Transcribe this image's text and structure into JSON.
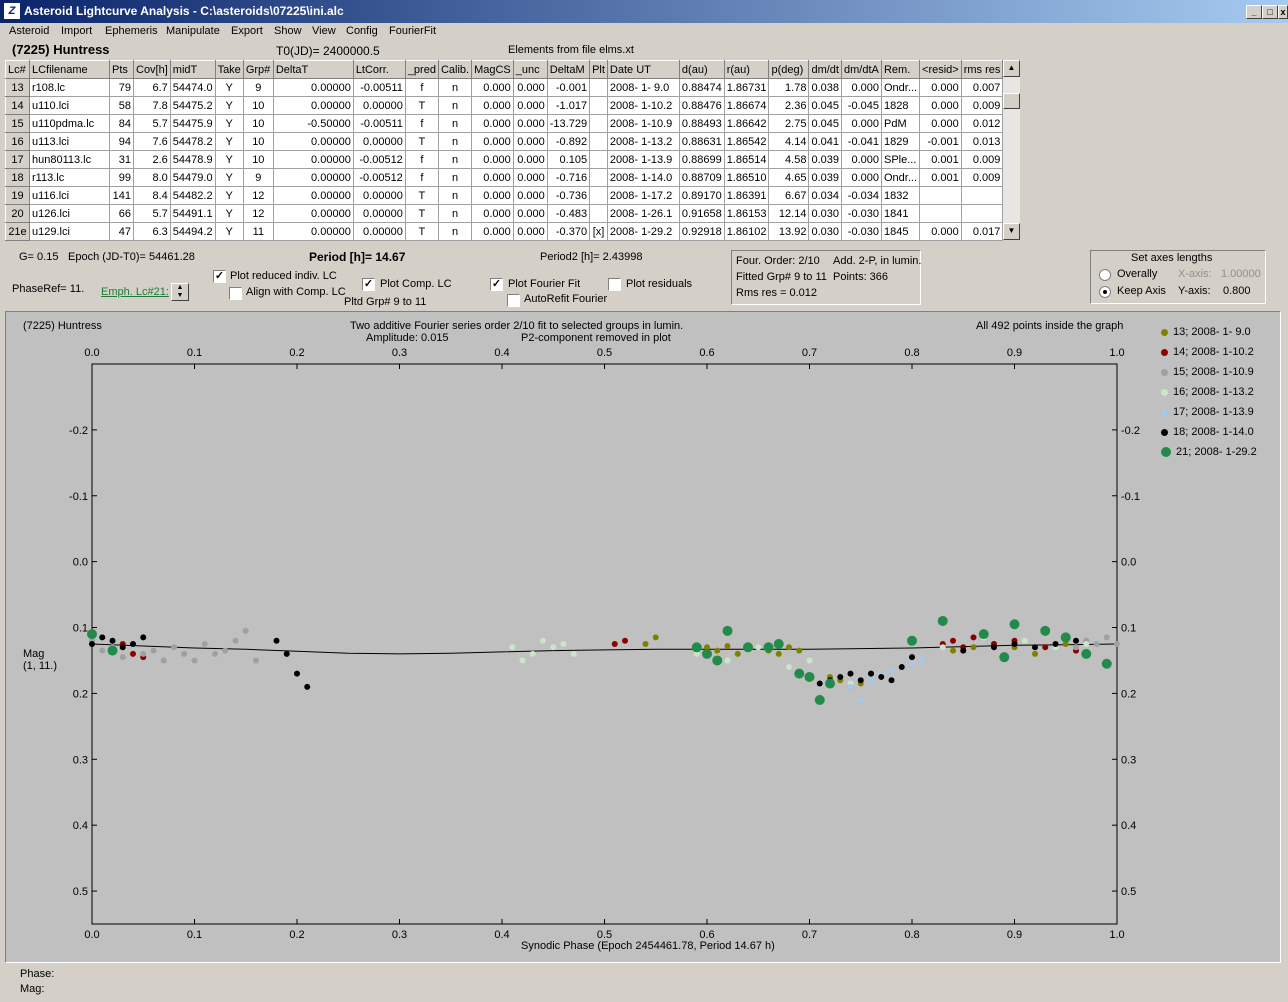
{
  "window": {
    "title": "Asteroid Lightcurve Analysis - C:\\asteroids\\07225\\ini.alc",
    "logo": "Z"
  },
  "menu": [
    "Asteroid",
    "Import",
    "Ephemeris",
    "Manipulate",
    "Export",
    "Show",
    "View",
    "Config",
    "FourierFit"
  ],
  "header": {
    "asteroid": "(7225) Huntress",
    "t0": "T0(JD)= 2400000.5",
    "elements": "Elements from file elms.xt"
  },
  "table": {
    "columns": [
      "Lc#",
      "LCfilename",
      "Pts",
      "Cov[h]",
      "midT",
      "Take",
      "Grp#",
      "DeltaT",
      "LtCorr.",
      "_pred",
      "Calib.",
      "MagCS",
      "_unc",
      "DeltaM",
      "Plt",
      "Date UT",
      "d(au)",
      "r(au)",
      "p(deg)",
      "dm/dt",
      "dm/dtA",
      "Rem.",
      "<resid>",
      "rms res"
    ],
    "rows": [
      [
        "13",
        "r108.lc",
        "79",
        "6.7",
        "54474.0",
        "Y",
        "9",
        "0.00000",
        "-0.00511",
        "f",
        "n",
        "0.000",
        "0.000",
        "-0.001",
        "",
        "2008- 1- 9.0",
        "0.88474",
        "1.86731",
        "1.78",
        "0.038",
        "0.000",
        "Ondr...",
        "0.000",
        "0.007"
      ],
      [
        "14",
        "u110.lci",
        "58",
        "7.8",
        "54475.2",
        "Y",
        "10",
        "0.00000",
        "0.00000",
        "T",
        "n",
        "0.000",
        "0.000",
        "-1.017",
        "",
        "2008- 1-10.2",
        "0.88476",
        "1.86674",
        "2.36",
        "0.045",
        "-0.045",
        "1828",
        "0.000",
        "0.009"
      ],
      [
        "15",
        "u110pdma.lc",
        "84",
        "5.7",
        "54475.9",
        "Y",
        "10",
        "-0.50000",
        "-0.00511",
        "f",
        "n",
        "0.000",
        "0.000",
        "-13.729",
        "",
        "2008- 1-10.9",
        "0.88493",
        "1.86642",
        "2.75",
        "0.045",
        "0.000",
        "PdM",
        "0.000",
        "0.012"
      ],
      [
        "16",
        "u113.lci",
        "94",
        "7.6",
        "54478.2",
        "Y",
        "10",
        "0.00000",
        "0.00000",
        "T",
        "n",
        "0.000",
        "0.000",
        "-0.892",
        "",
        "2008- 1-13.2",
        "0.88631",
        "1.86542",
        "4.14",
        "0.041",
        "-0.041",
        "1829",
        "-0.001",
        "0.013"
      ],
      [
        "17",
        "hun80113.lc",
        "31",
        "2.6",
        "54478.9",
        "Y",
        "10",
        "0.00000",
        "-0.00512",
        "f",
        "n",
        "0.000",
        "0.000",
        "0.105",
        "",
        "2008- 1-13.9",
        "0.88699",
        "1.86514",
        "4.58",
        "0.039",
        "0.000",
        "SPle...",
        "0.001",
        "0.009"
      ],
      [
        "18",
        "r113.lc",
        "99",
        "8.0",
        "54479.0",
        "Y",
        "9",
        "0.00000",
        "-0.00512",
        "f",
        "n",
        "0.000",
        "0.000",
        "-0.716",
        "",
        "2008- 1-14.0",
        "0.88709",
        "1.86510",
        "4.65",
        "0.039",
        "0.000",
        "Ondr...",
        "0.001",
        "0.009"
      ],
      [
        "19",
        "u116.lci",
        "141",
        "8.4",
        "54482.2",
        "Y",
        "12",
        "0.00000",
        "0.00000",
        "T",
        "n",
        "0.000",
        "0.000",
        "-0.736",
        "",
        "2008- 1-17.2",
        "0.89170",
        "1.86391",
        "6.67",
        "0.034",
        "-0.034",
        "1832",
        "",
        ""
      ],
      [
        "20",
        "u126.lci",
        "66",
        "5.7",
        "54491.1",
        "Y",
        "12",
        "0.00000",
        "0.00000",
        "T",
        "n",
        "0.000",
        "0.000",
        "-0.483",
        "",
        "2008- 1-26.1",
        "0.91658",
        "1.86153",
        "12.14",
        "0.030",
        "-0.030",
        "1841",
        "",
        ""
      ],
      [
        "21e",
        "u129.lci",
        "47",
        "6.3",
        "54494.2",
        "Y",
        "11",
        "0.00000",
        "0.00000",
        "T",
        "n",
        "0.000",
        "0.000",
        "-0.370",
        "[x]",
        "2008- 1-29.2",
        "0.92918",
        "1.86102",
        "13.92",
        "0.030",
        "-0.030",
        "1845",
        "0.000",
        "0.017"
      ]
    ]
  },
  "controls": {
    "g": "G= 0.15",
    "epoch": "Epoch (JD-T0)= 54461.28",
    "period": "Period [h]= 14.67",
    "period2": "Period2 [h]= 2.43998",
    "phaseref": "PhaseRef= 11.",
    "emph": "Emph. Lc#21:",
    "plot_reduced": "Plot reduced indiv. LC",
    "align": "Align with Comp. LC",
    "plot_comp": "Plot Comp. LC",
    "pltd_grp": "Pltd Grp#  9   to   11",
    "plot_fourier": "Plot Fourier Fit",
    "autorefit": "AutoRefit Fourier",
    "plot_resid": "Plot residuals",
    "checks": {
      "plot_reduced": true,
      "align": false,
      "plot_comp": true,
      "plot_fourier": true,
      "autorefit": false,
      "plot_resid": false
    },
    "fourier_info": [
      "Four. Order:  2/10",
      "Add. 2-P, in lumin.",
      "Fitted Grp# 9 to 11",
      "Points: 366",
      "Rms res      = 0.012"
    ],
    "axes": {
      "title": "Set axes lengths",
      "overally": "Overally",
      "keep": "Keep Axis",
      "xaxis_label": "X-axis:",
      "xaxis_val": "1.00000",
      "yaxis_label": "Y-axis:",
      "yaxis_val": "0.800",
      "selected": "keep"
    }
  },
  "chart_data": {
    "type": "scatter",
    "title": "Two additive Fourier series order 2/10 fit to selected groups in lumin.",
    "subtitle": "Amplitude: 0.015",
    "note": "P2-component removed in plot",
    "object": "(7225) Huntress",
    "points_note": "All 492 points inside the graph",
    "xlabel": "Synodic Phase (Epoch 2454461.78, Period 14.67 h)",
    "ylabel": "Mag\n(1, 11.)",
    "xlim": [
      0,
      1
    ],
    "ylim": [
      -0.3,
      0.55
    ],
    "x_ticks": [
      "0.0",
      "0.1",
      "0.2",
      "0.3",
      "0.4",
      "0.5",
      "0.6",
      "0.7",
      "0.8",
      "0.9",
      "1.0"
    ],
    "y_ticks": [
      "-0.2",
      "-0.1",
      "0.0",
      "0.1",
      "0.2",
      "0.3",
      "0.4",
      "0.5"
    ],
    "legend": [
      {
        "label": "13; 2008- 1- 9.0",
        "color": "#808000"
      },
      {
        "label": "14; 2008- 1-10.2",
        "color": "#8b0000"
      },
      {
        "label": "15; 2008- 1-10.9",
        "color": "#a0a0a0"
      },
      {
        "label": "16; 2008- 1-13.2",
        "color": "#c8e6c8"
      },
      {
        "label": "17; 2008- 1-13.9",
        "color": "#a8c8e8"
      },
      {
        "label": "18; 2008- 1-14.0",
        "color": "#000000"
      },
      {
        "label": "21; 2008- 1-29.2",
        "color": "#228b4b"
      }
    ],
    "fit": {
      "x": [
        0,
        0.05,
        0.1,
        0.15,
        0.2,
        0.25,
        0.3,
        0.35,
        0.4,
        0.45,
        0.5,
        0.55,
        0.6,
        0.65,
        0.7,
        0.75,
        0.8,
        0.85,
        0.9,
        0.95,
        1.0
      ],
      "y": [
        0.125,
        0.128,
        0.131,
        0.133,
        0.136,
        0.139,
        0.14,
        0.139,
        0.137,
        0.135,
        0.134,
        0.133,
        0.133,
        0.133,
        0.133,
        0.132,
        0.131,
        0.129,
        0.127,
        0.126,
        0.125
      ]
    },
    "series": [
      {
        "name": "13; 2008- 1- 9.0",
        "color": "#808000",
        "r": 3,
        "x": [
          0.54,
          0.55,
          0.6,
          0.61,
          0.62,
          0.63,
          0.64,
          0.66,
          0.67,
          0.68,
          0.69,
          0.72,
          0.73,
          0.74,
          0.75,
          0.76,
          0.84,
          0.86,
          0.88,
          0.9,
          0.92,
          0.95,
          0.97
        ],
        "y": [
          0.125,
          0.115,
          0.13,
          0.135,
          0.128,
          0.14,
          0.13,
          0.135,
          0.14,
          0.13,
          0.135,
          0.175,
          0.18,
          0.19,
          0.185,
          0.17,
          0.135,
          0.13,
          0.125,
          0.13,
          0.14,
          0.125,
          0.12
        ]
      },
      {
        "name": "14; 2008- 1-10.2",
        "color": "#8b0000",
        "r": 3,
        "x": [
          0.03,
          0.04,
          0.05,
          0.51,
          0.52,
          0.83,
          0.84,
          0.85,
          0.86,
          0.88,
          0.9,
          0.93,
          0.96
        ],
        "y": [
          0.125,
          0.14,
          0.145,
          0.125,
          0.12,
          0.125,
          0.12,
          0.13,
          0.115,
          0.125,
          0.12,
          0.13,
          0.135
        ]
      },
      {
        "name": "15; 2008- 1-10.9",
        "color": "#a0a0a0",
        "r": 3,
        "x": [
          0.0,
          0.01,
          0.02,
          0.03,
          0.05,
          0.06,
          0.07,
          0.08,
          0.09,
          0.1,
          0.11,
          0.12,
          0.13,
          0.14,
          0.15,
          0.16,
          0.95,
          0.96,
          0.97,
          0.98,
          0.99,
          1.0
        ],
        "y": [
          0.12,
          0.135,
          0.13,
          0.145,
          0.14,
          0.135,
          0.15,
          0.13,
          0.14,
          0.15,
          0.125,
          0.14,
          0.135,
          0.12,
          0.105,
          0.15,
          0.115,
          0.13,
          0.12,
          0.125,
          0.115,
          0.125
        ]
      },
      {
        "name": "16; 2008- 1-13.2",
        "color": "#c8e6c8",
        "r": 3,
        "x": [
          0.41,
          0.42,
          0.43,
          0.44,
          0.45,
          0.46,
          0.47,
          0.59,
          0.62,
          0.65,
          0.68,
          0.7,
          0.74,
          0.77,
          0.8,
          0.83,
          0.87,
          0.91,
          0.94,
          0.97
        ],
        "y": [
          0.13,
          0.15,
          0.14,
          0.12,
          0.13,
          0.125,
          0.14,
          0.14,
          0.15,
          0.13,
          0.16,
          0.15,
          0.185,
          0.17,
          0.145,
          0.13,
          0.115,
          0.12,
          0.13,
          0.125
        ]
      },
      {
        "name": "17; 2008- 1-13.9",
        "color": "#a8c8e8",
        "r": 3,
        "x": [
          0.74,
          0.75,
          0.76,
          0.77,
          0.78,
          0.79,
          0.8,
          0.81
        ],
        "y": [
          0.19,
          0.21,
          0.18,
          0.17,
          0.165,
          0.16,
          0.155,
          0.15
        ]
      },
      {
        "name": "18; 2008- 1-14.0",
        "color": "#000000",
        "r": 3,
        "x": [
          0.0,
          0.01,
          0.02,
          0.03,
          0.04,
          0.05,
          0.18,
          0.19,
          0.2,
          0.21,
          0.7,
          0.71,
          0.72,
          0.73,
          0.74,
          0.75,
          0.76,
          0.77,
          0.78,
          0.79,
          0.8,
          0.85,
          0.88,
          0.9,
          0.92,
          0.94,
          0.96
        ],
        "y": [
          0.125,
          0.115,
          0.12,
          0.13,
          0.125,
          0.115,
          0.12,
          0.14,
          0.17,
          0.19,
          0.175,
          0.185,
          0.18,
          0.175,
          0.17,
          0.18,
          0.17,
          0.175,
          0.18,
          0.16,
          0.145,
          0.135,
          0.13,
          0.125,
          0.13,
          0.125,
          0.12
        ]
      },
      {
        "name": "21; 2008- 1-29.2",
        "color": "#228b4b",
        "r": 5,
        "x": [
          0.0,
          0.02,
          0.59,
          0.6,
          0.61,
          0.62,
          0.64,
          0.66,
          0.67,
          0.69,
          0.7,
          0.71,
          0.72,
          0.8,
          0.83,
          0.87,
          0.89,
          0.9,
          0.93,
          0.95,
          0.97,
          0.99
        ],
        "y": [
          0.11,
          0.135,
          0.13,
          0.14,
          0.15,
          0.105,
          0.13,
          0.13,
          0.125,
          0.17,
          0.175,
          0.21,
          0.185,
          0.12,
          0.09,
          0.11,
          0.145,
          0.095,
          0.105,
          0.115,
          0.14,
          0.155
        ]
      }
    ]
  },
  "status": {
    "phase": "Phase:",
    "mag": "Mag:"
  }
}
